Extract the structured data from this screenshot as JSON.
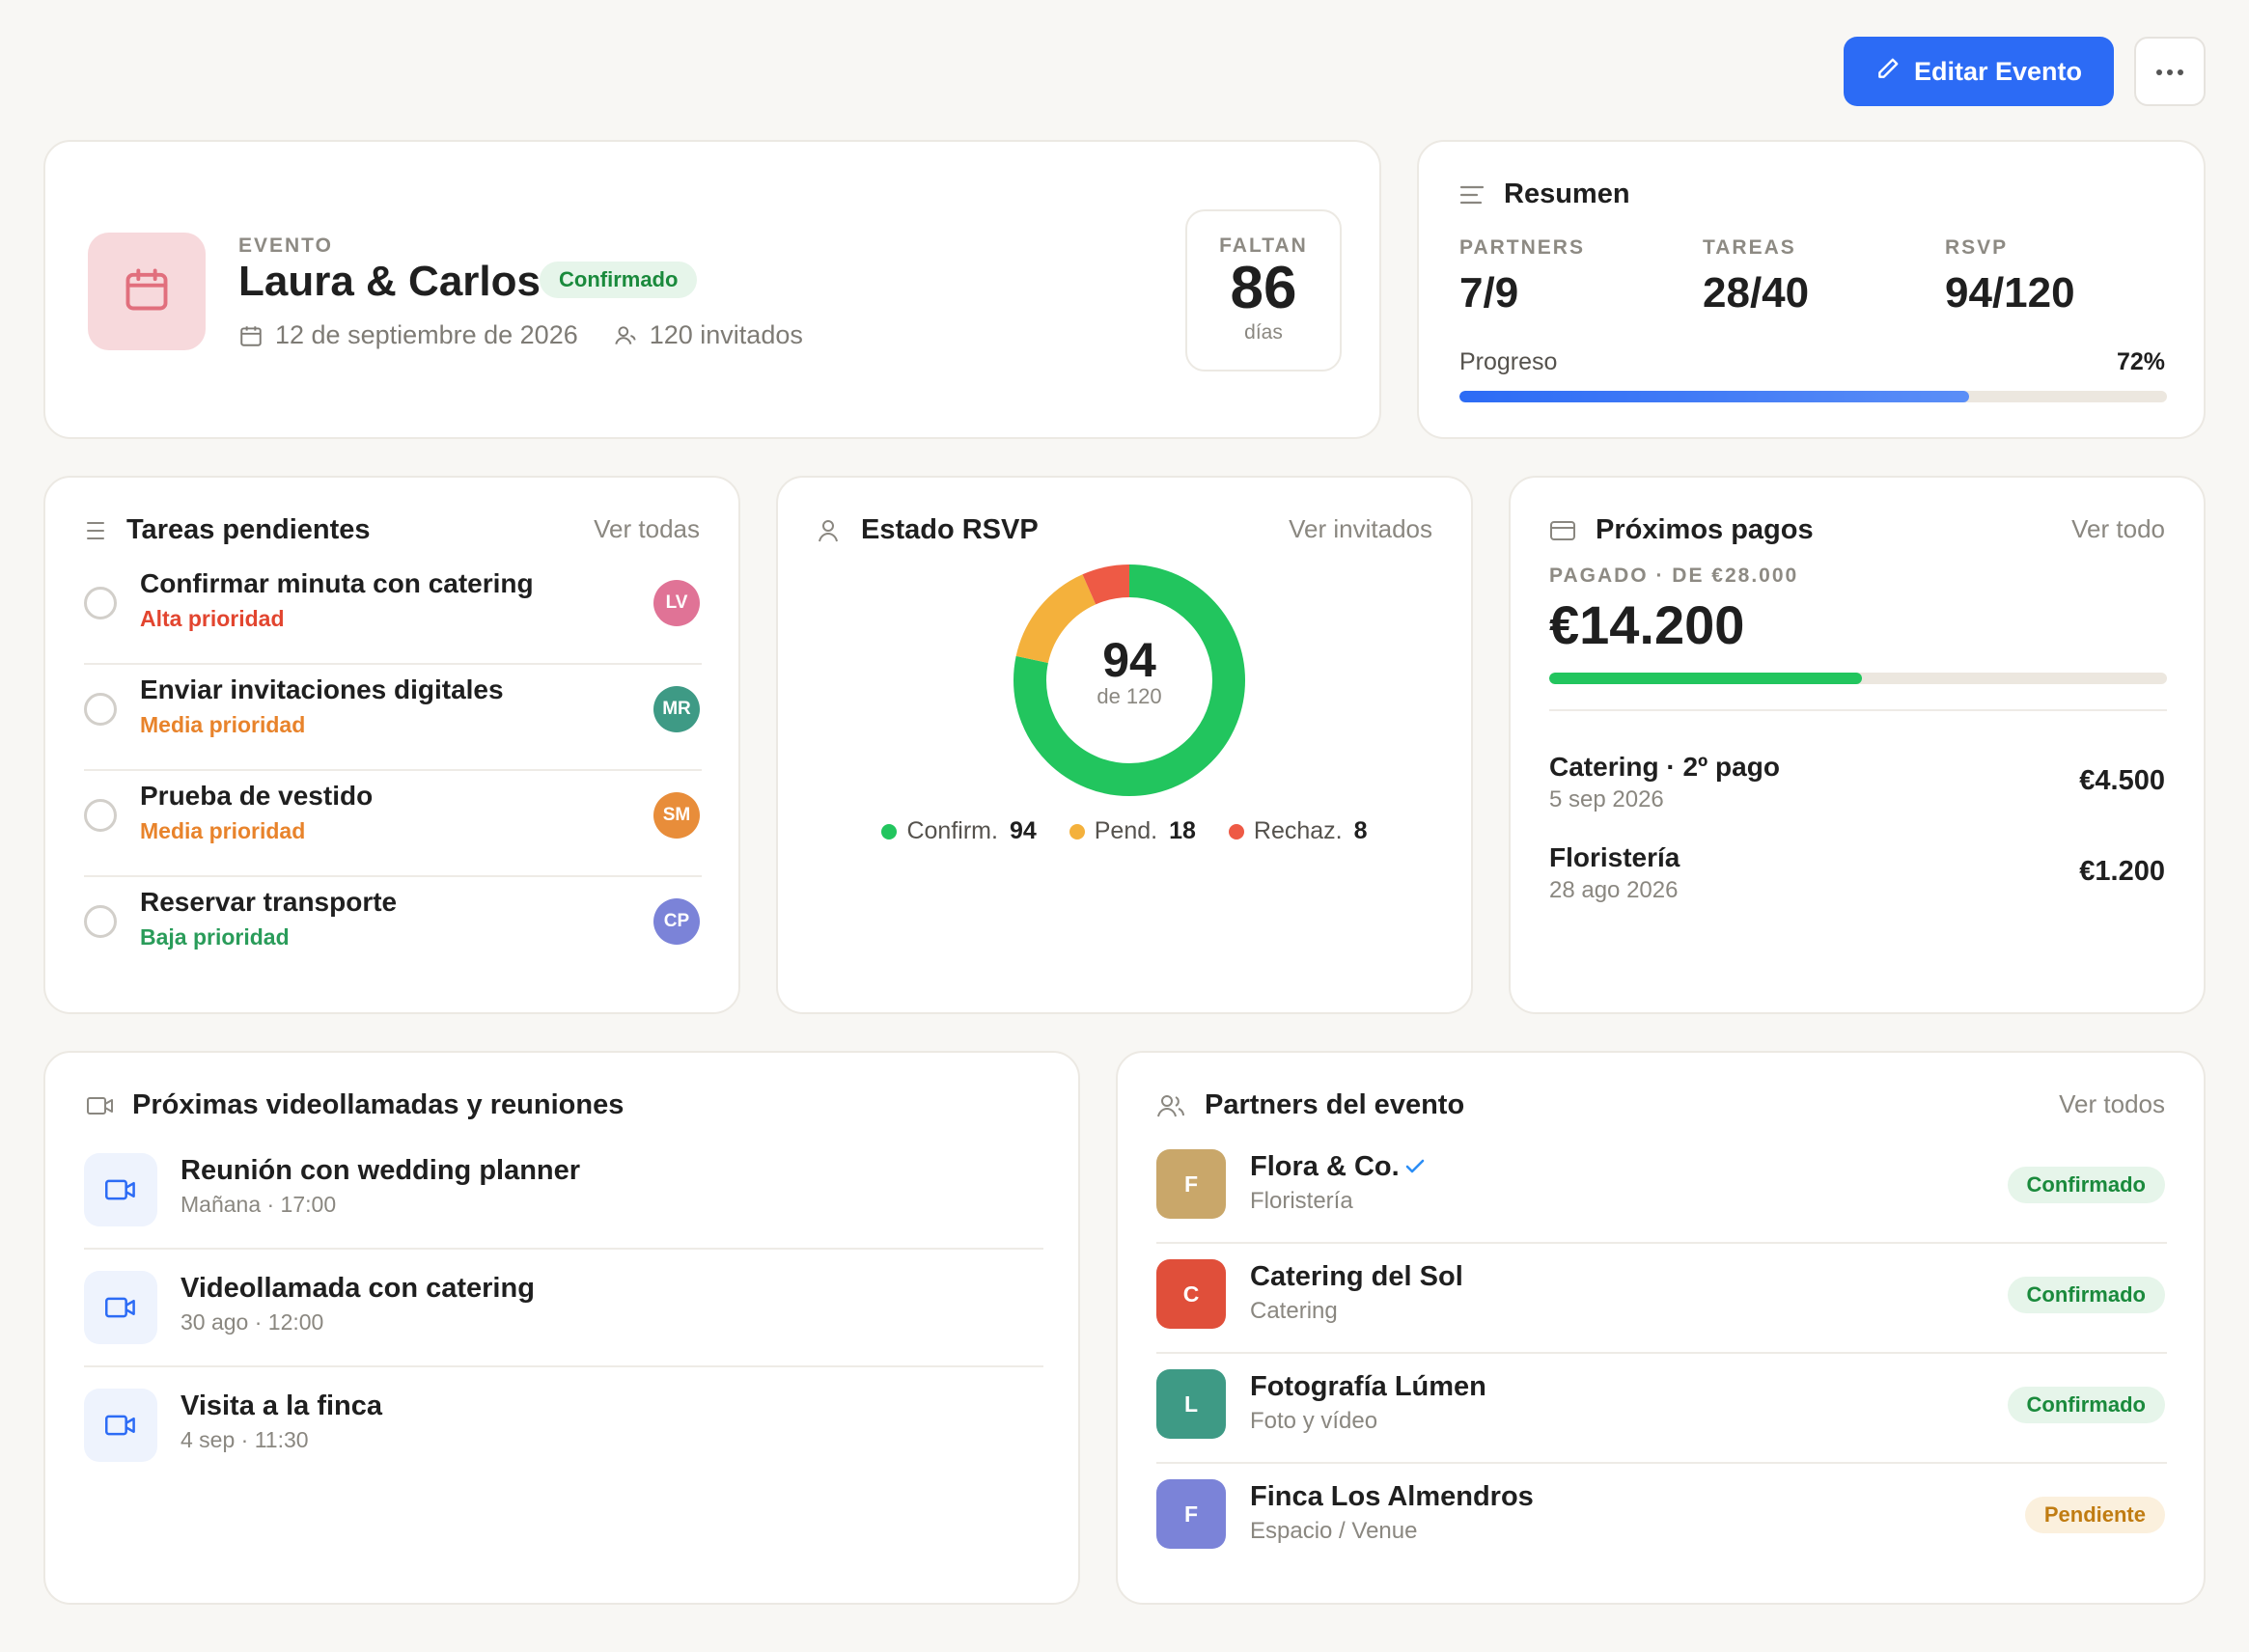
{
  "toolbar": {
    "edit_label": "Editar Evento",
    "edit_icon": "pencil-icon",
    "more_icon": "more-horizontal-icon",
    "accent": "#2c6bf5"
  },
  "event": {
    "label": "EVENTO",
    "title": "Laura & Carlos",
    "status": "Confirmado",
    "date": "12 de septiembre de 2026",
    "guests": "120 invitados",
    "countdown_label": "FALTAN",
    "countdown_value": "86",
    "countdown_unit": "días",
    "icon": "calendar-icon"
  },
  "summary": {
    "title": "Resumen",
    "stats": [
      {
        "label": "PARTNERS",
        "value": "7/9"
      },
      {
        "label": "TAREAS",
        "value": "28/40"
      },
      {
        "label": "RSVP",
        "value": "94/120"
      }
    ],
    "progress_label": "Progreso",
    "progress_text": "72%",
    "progress_value": 0.72
  },
  "tasks": {
    "title": "Tareas pendientes",
    "link": "Ver todas",
    "items": [
      {
        "title": "Confirmar minuta con catering",
        "priority": "Alta prioridad",
        "priority_color": "#e2452f",
        "initials": "LV",
        "avatar_color": "#e07396"
      },
      {
        "title": "Enviar invitaciones digitales",
        "priority": "Media prioridad",
        "priority_color": "#e8832b",
        "initials": "MR",
        "avatar_color": "#3e9a85"
      },
      {
        "title": "Prueba de vestido",
        "priority": "Media prioridad",
        "priority_color": "#e8832b",
        "initials": "SM",
        "avatar_color": "#e88d3a"
      },
      {
        "title": "Reservar transporte",
        "priority": "Baja prioridad",
        "priority_color": "#2a9c5a",
        "initials": "CP",
        "avatar_color": "#7b83d8"
      }
    ]
  },
  "rsvp": {
    "title": "Estado RSVP",
    "link": "Ver invitados",
    "center_value": "94",
    "center_label": "de 120",
    "legend": [
      {
        "label": "Confirm.",
        "value": "94",
        "color": "#22c55e"
      },
      {
        "label": "Pend.",
        "value": "18",
        "color": "#f4b13c"
      },
      {
        "label": "Rechaz.",
        "value": "8",
        "color": "#ee5a45"
      }
    ]
  },
  "payments": {
    "title": "Próximos pagos",
    "link": "Ver todo",
    "paid_label": "PAGADO · DE €28.000",
    "paid_amount": "€14.200",
    "paid_fraction": 0.507,
    "items": [
      {
        "name": "Catering · 2º pago",
        "date": "5 sep 2026",
        "amount": "€4.500"
      },
      {
        "name": "Floristería",
        "date": "28 ago 2026",
        "amount": "€1.200"
      }
    ]
  },
  "meetings": {
    "title": "Próximas videollamadas y reuniones",
    "items": [
      {
        "title": "Reunión con wedding planner",
        "time": "Mañana · 17:00"
      },
      {
        "title": "Videollamada con catering",
        "time": "30 ago · 12:00"
      },
      {
        "title": "Visita a la finca",
        "time": "4 sep · 11:30"
      }
    ]
  },
  "partners": {
    "title": "Partners del evento",
    "link": "Ver todos",
    "items": [
      {
        "initial": "F",
        "name": "Flora & Co.",
        "category": "Floristería",
        "status": "Confirmado",
        "color": "#c9a76a",
        "verified": true
      },
      {
        "initial": "C",
        "name": "Catering del Sol",
        "category": "Catering",
        "status": "Confirmado",
        "color": "#e04f3a",
        "verified": false
      },
      {
        "initial": "L",
        "name": "Fotografía Lúmen",
        "category": "Foto y vídeo",
        "status": "Confirmado",
        "color": "#3e9a85",
        "verified": false
      },
      {
        "initial": "F",
        "name": "Finca Los Almendros",
        "category": "Espacio / Venue",
        "status": "Pendiente",
        "color": "#7b83d8",
        "verified": false
      }
    ]
  }
}
